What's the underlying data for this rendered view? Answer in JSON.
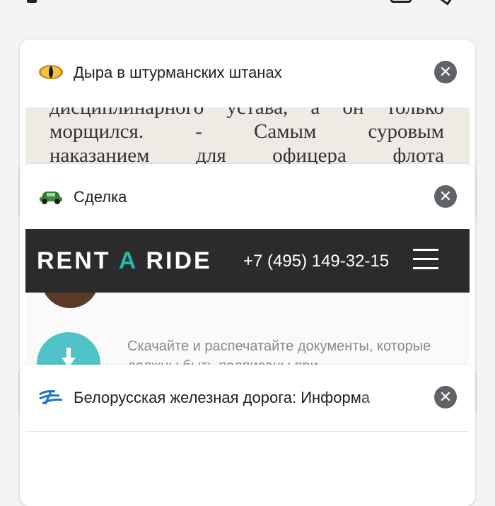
{
  "tabs": [
    {
      "title": "Дыра в штурманских штанах",
      "favicon": "cat-eye-icon",
      "preview_text": [
        "дисциплинарного устава, а он только",
        "морщился.    -    Самым    суровым",
        "наказанием    для    офицера    флота"
      ]
    },
    {
      "title": "Сделка",
      "favicon": "green-car-icon",
      "site_logo_left": "RENT ",
      "site_logo_accent": "A",
      "site_logo_right": " RIDE",
      "site_phone": "+7 (495) 149-32-15",
      "download_text": "Скачайте и распечатайте документы, которые должны быть подписаны при"
    },
    {
      "title": "Белорусская железная дорога: Информа",
      "favicon": "railway-logo-icon"
    }
  ],
  "colors": {
    "accent": "#22b8b1",
    "close_button": "#5f6368",
    "header_bar": "#2b2b2b",
    "download_button": "#4fc3c8"
  }
}
